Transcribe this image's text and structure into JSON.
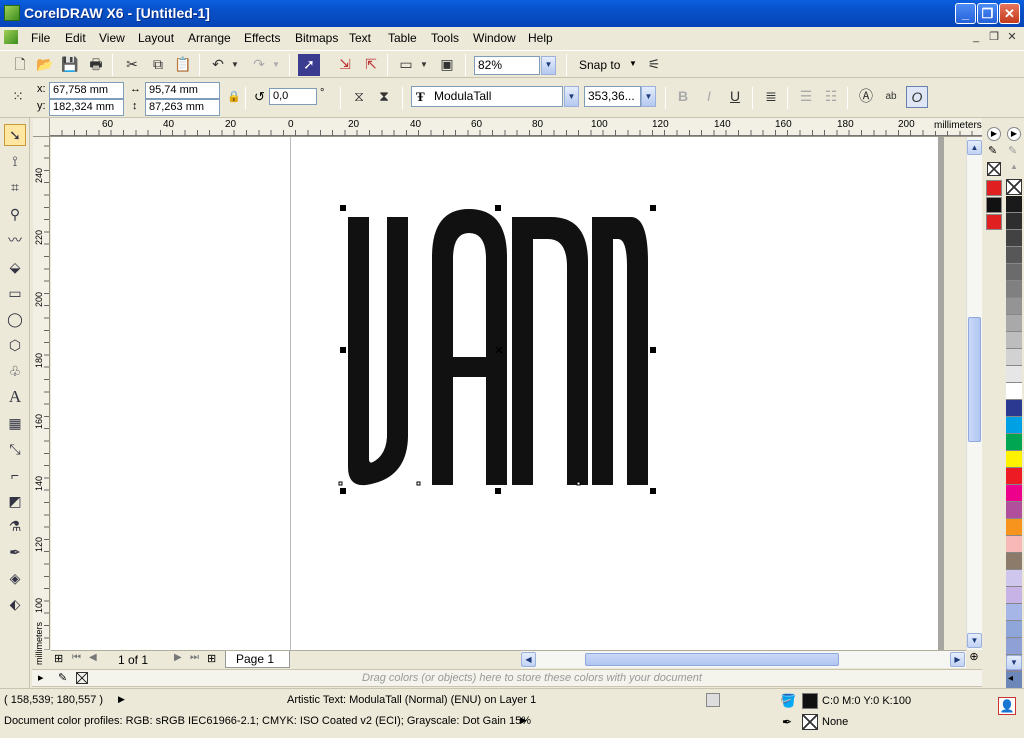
{
  "window": {
    "title": "CorelDRAW X6 - [Untitled-1]"
  },
  "menu": [
    "File",
    "Edit",
    "View",
    "Layout",
    "Arrange",
    "Effects",
    "Bitmaps",
    "Text",
    "Table",
    "Tools",
    "Window",
    "Help"
  ],
  "toolbar": {
    "zoom": "82%",
    "snap_label": "Snap to"
  },
  "props": {
    "x_label": "x:",
    "x_value": "67,758 mm",
    "y_label": "y:",
    "y_value": "182,324 mm",
    "width_value": "95,74 mm",
    "height_value": "87,263 mm",
    "rotation_value": "0,0",
    "rotation_unit": "°",
    "font_name": "ModulaTall",
    "font_size": "353,36..."
  },
  "rulers": {
    "unit": "millimeters",
    "h_ticks": [
      "60",
      "40",
      "20",
      "0",
      "20",
      "40",
      "60",
      "80",
      "100",
      "120",
      "140",
      "160",
      "180",
      "200"
    ],
    "v_ticks": [
      "240",
      "220",
      "200",
      "180",
      "160",
      "140",
      "120",
      "100"
    ]
  },
  "canvas": {
    "artistic_text": "VANN"
  },
  "pages": {
    "count_text": "1 of 1",
    "tab_label": "Page 1"
  },
  "color_well_hint": "Drag colors (or objects) here to store these colors with your document",
  "status": {
    "coords": "( 158,539; 180,557 )",
    "object_info": "Artistic Text: ModulaTall (Normal) (ENU) on Layer 1",
    "fill_value": "C:0 M:0 Y:0 K:100",
    "outline_value": "None",
    "color_profiles": "Document color profiles: RGB: sRGB IEC61966-2.1; CMYK: ISO Coated v2 (ECI); Grayscale: Dot Gain 15%"
  },
  "colors": {
    "palette": [
      "#1a1a1a",
      "#2e2e2e",
      "#424242",
      "#575757",
      "#6b6b6b",
      "#808080",
      "#949494",
      "#a9a9a9",
      "#bdbdbd",
      "#d2d2d2",
      "#e6e6e6",
      "#ffffff",
      "#2B3990",
      "#00A1E4",
      "#00A651",
      "#FFF200",
      "#ED1C24",
      "#EC008C",
      "#B14F9C",
      "#F7941D",
      "#F9B8B8",
      "#8C7B6B",
      "#CFC6EE",
      "#C8B3E6",
      "#A6B6E6",
      "#8FA6DA",
      "#8FA0D6",
      "#7F7FC4",
      "#6C87B8",
      "#5A6C9C"
    ]
  }
}
